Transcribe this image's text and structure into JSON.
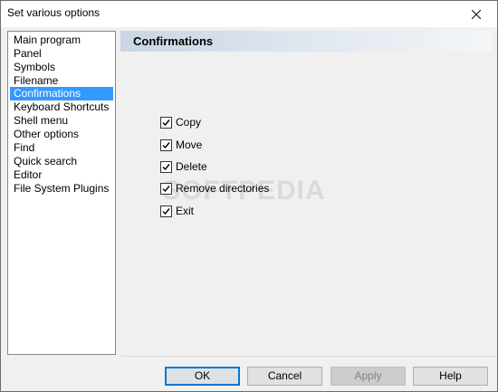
{
  "window": {
    "title": "Set various options"
  },
  "sidebar": {
    "items": [
      {
        "label": "Main program"
      },
      {
        "label": "Panel"
      },
      {
        "label": "Symbols"
      },
      {
        "label": "Filename"
      },
      {
        "label": "Confirmations",
        "selected": true
      },
      {
        "label": "Keyboard Shortcuts"
      },
      {
        "label": "Shell menu"
      },
      {
        "label": "Other options"
      },
      {
        "label": "Find"
      },
      {
        "label": "Quick search"
      },
      {
        "label": "Editor"
      },
      {
        "label": "File System Plugins"
      }
    ]
  },
  "panel": {
    "title": "Confirmations",
    "options": [
      {
        "label": "Copy",
        "checked": true
      },
      {
        "label": "Move",
        "checked": true
      },
      {
        "label": "Delete",
        "checked": true
      },
      {
        "label": "Remove directories",
        "checked": true
      },
      {
        "label": "Exit",
        "checked": true
      }
    ]
  },
  "watermark": "SOFTPEDIA",
  "buttons": {
    "ok": "OK",
    "cancel": "Cancel",
    "apply": "Apply",
    "help": "Help"
  },
  "colors": {
    "selection": "#3399ff",
    "default_button_border": "#0078d7"
  }
}
